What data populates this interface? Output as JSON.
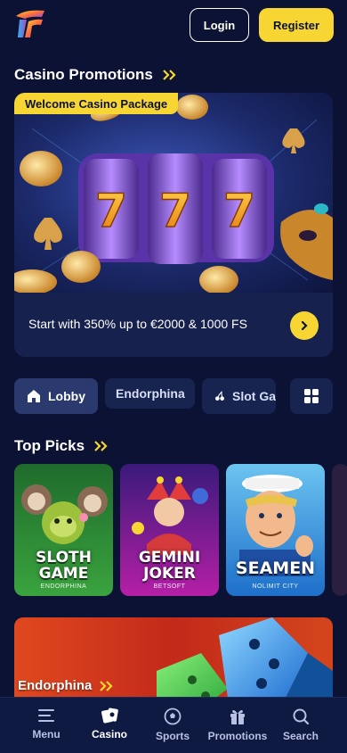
{
  "header": {
    "logo_icon": "brand-logo-icon",
    "login_label": "Login",
    "register_label": "Register"
  },
  "promotions": {
    "title": "Casino Promotions",
    "badge": "Welcome Casino Package",
    "text": "Start with 350% up to €2000 & 1000 FS",
    "arrow_icon": "chevron-right-icon"
  },
  "tabs": [
    {
      "label": "Lobby",
      "icon": "home-icon",
      "active": true
    },
    {
      "label": "Endorphina",
      "active": false
    },
    {
      "label": "Slot Ga",
      "icon": "cherries-icon",
      "active": false
    },
    {
      "label": "",
      "icon": "grid-icon",
      "active": false
    }
  ],
  "top_picks": {
    "title": "Top Picks",
    "games": [
      {
        "name_line1": "SLOTH",
        "name_line2": "GAME",
        "provider": "ENDORPHINA"
      },
      {
        "name_line1": "GEMINI",
        "name_line2": "JOKER",
        "provider": "BETSOFT"
      },
      {
        "name_line1": "SEAMEN",
        "name_line2": "",
        "provider": "NOLIMIT CITY"
      }
    ]
  },
  "banner": {
    "title": "Endorphina"
  },
  "bottom_nav": [
    {
      "label": "Menu",
      "icon": "menu-icon",
      "active": false
    },
    {
      "label": "Casino",
      "icon": "casino-cards-icon",
      "active": true
    },
    {
      "label": "Sports",
      "icon": "soccer-ball-icon",
      "active": false
    },
    {
      "label": "Promotions",
      "icon": "gift-icon",
      "active": false
    },
    {
      "label": "Search",
      "icon": "search-icon",
      "active": false
    }
  ],
  "colors": {
    "background": "#0b1233",
    "accent": "#f7d633",
    "card": "#16224d"
  }
}
